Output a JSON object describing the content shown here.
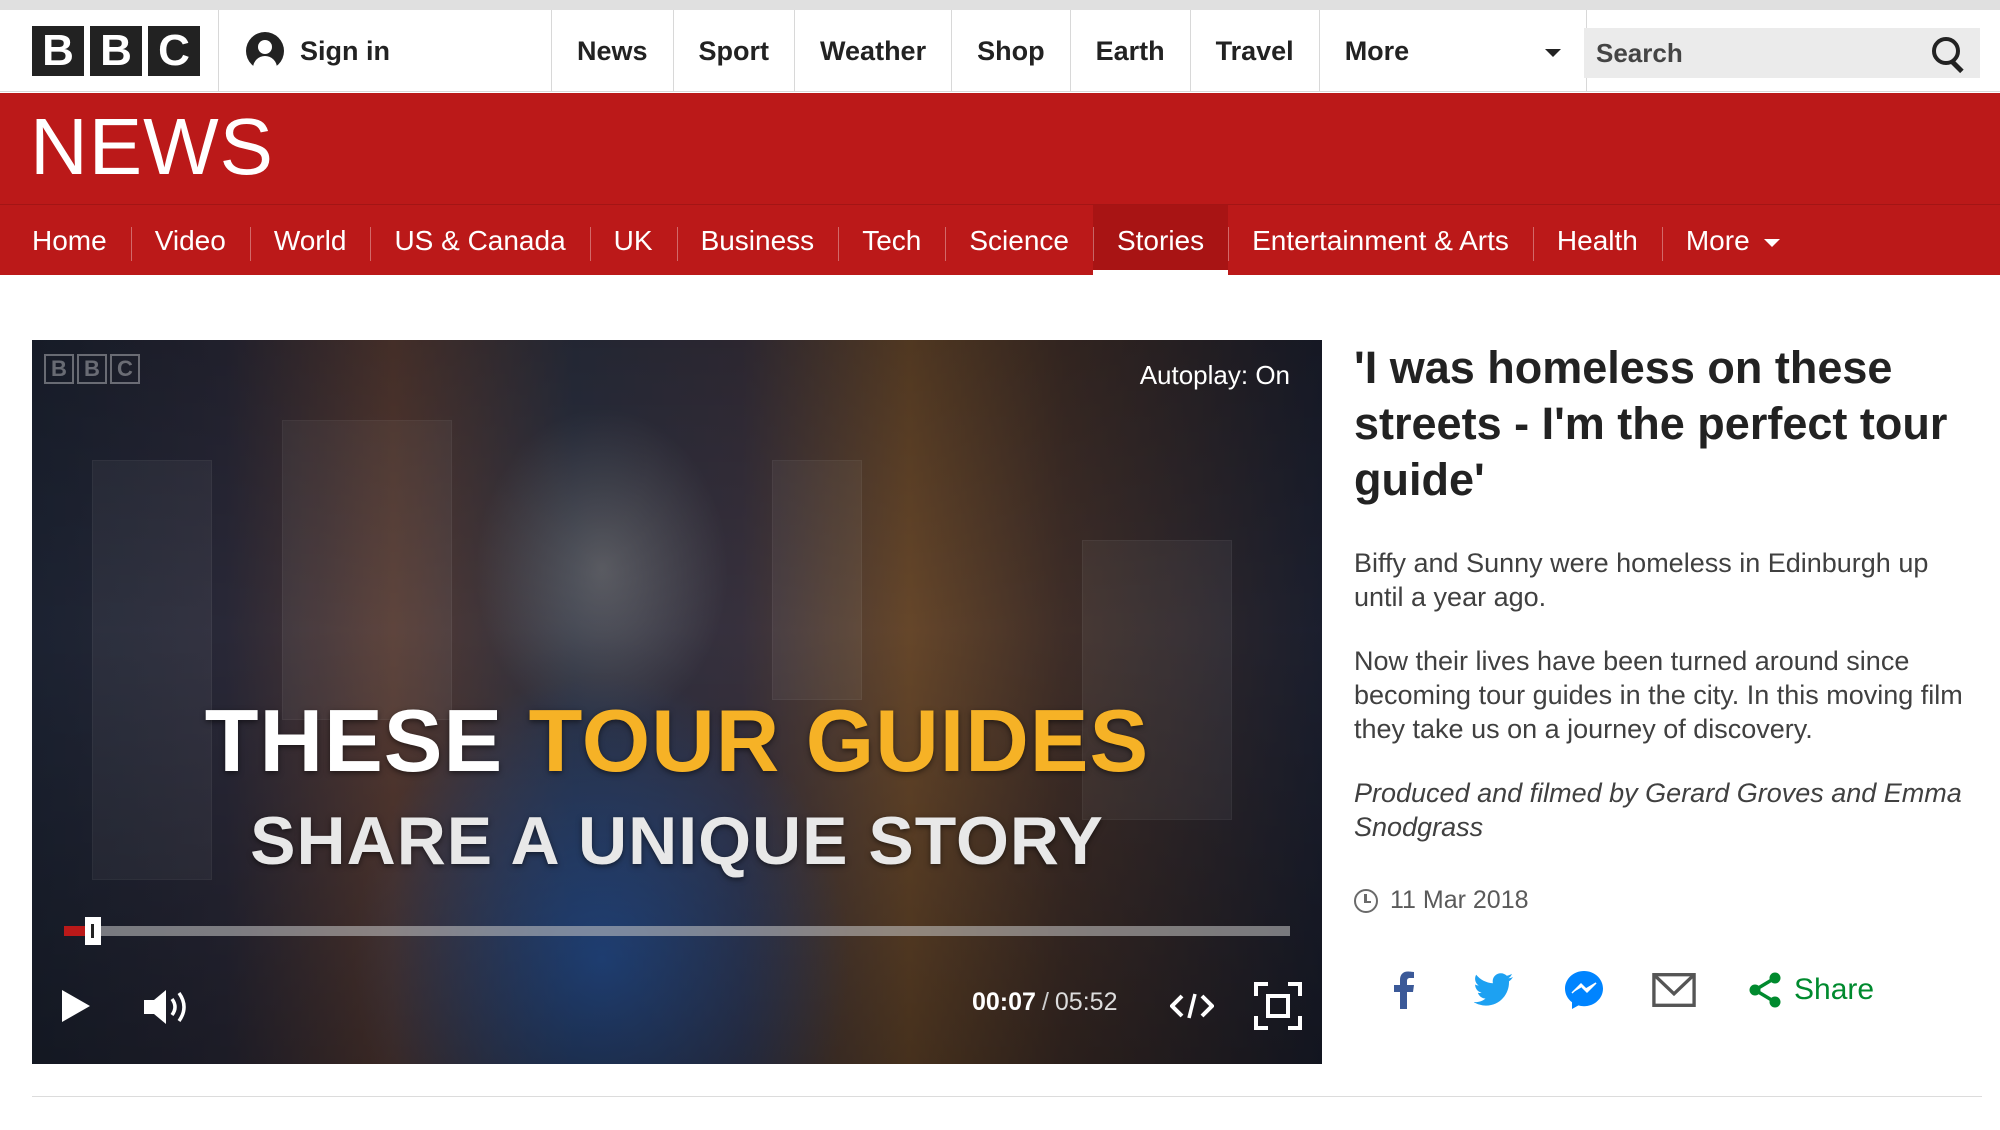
{
  "masthead": {
    "logo_letters": [
      "B",
      "B",
      "C"
    ],
    "sign_in": "Sign in",
    "nav": [
      "News",
      "Sport",
      "Weather",
      "Shop",
      "Earth",
      "Travel"
    ],
    "more": "More",
    "search_placeholder": "Search"
  },
  "news_band": {
    "title": "NEWS"
  },
  "news_nav": {
    "tabs": [
      "Home",
      "Video",
      "World",
      "US & Canada",
      "UK",
      "Business",
      "Tech",
      "Science",
      "Stories",
      "Entertainment & Arts",
      "Health"
    ],
    "active_tab": "Stories",
    "more": "More"
  },
  "player": {
    "watermark_letters": [
      "B",
      "B",
      "C"
    ],
    "autoplay": "Autoplay: On",
    "overlay_line1_part1": "THESE",
    "overlay_line1_part2": "TOUR GUIDES",
    "overlay_line2": "SHARE A UNIQUE STORY",
    "current_time": "00:07",
    "time_separator": "/",
    "duration": "05:52",
    "progress_fraction": 0.02
  },
  "article": {
    "headline": "'I was homeless on these streets - I'm the perfect tour guide'",
    "para1": "Biffy and Sunny were homeless in Edinburgh up until a year ago.",
    "para2": "Now their lives have been turned around since becoming tour guides in the city. In this moving film they take us on a journey of discovery.",
    "credit": "Produced and filmed by Gerard Groves and Emma Snodgrass",
    "date": "11 Mar 2018"
  },
  "share": {
    "label": "Share",
    "icons": [
      "facebook-icon",
      "twitter-icon",
      "messenger-icon",
      "email-icon",
      "share-icon"
    ]
  },
  "colors": {
    "bbc_red": "#bb1919",
    "highlight_yellow": "#f6b226",
    "share_green": "#008a2e",
    "facebook_blue": "#3b5998",
    "twitter_blue": "#1da1f2",
    "messenger_blue": "#0084ff"
  }
}
